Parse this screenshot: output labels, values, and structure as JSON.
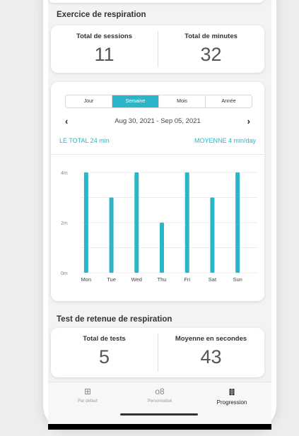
{
  "breathing_exercise": {
    "title": "Exercice de respiration",
    "total_sessions_label": "Total de sessions",
    "total_sessions_value": "11",
    "total_minutes_label": "Total de minutes",
    "total_minutes_value": "32"
  },
  "period_tabs": [
    {
      "label": "Jour",
      "active": false
    },
    {
      "label": "Semaine",
      "active": true
    },
    {
      "label": "Mois",
      "active": false
    },
    {
      "label": "Année",
      "active": false
    }
  ],
  "date_range": "Aug 30, 2021 - Sep 05, 2021",
  "total_text": "LE TOTAL 24 min",
  "average_text": "MOYENNE 4 min/day",
  "chart_data": {
    "type": "bar",
    "categories": [
      "Mon",
      "Tue",
      "Wed",
      "Thu",
      "Fri",
      "Sat",
      "Sun"
    ],
    "values": [
      4,
      3,
      4,
      2,
      4,
      3,
      4
    ],
    "ylim": [
      0,
      4
    ],
    "yticks": [
      "0m",
      "2m",
      "4m"
    ],
    "grid": true,
    "bar_color": "#2bb5c9"
  },
  "breath_hold": {
    "title": "Test de retenue de respiration",
    "total_tests_label": "Total de tests",
    "total_tests_value": "5",
    "average_seconds_label": "Moyenne en secondes",
    "average_seconds_value": "43"
  },
  "nav": {
    "items": [
      {
        "label": "Par défaut",
        "icon": "grid-icon"
      },
      {
        "label": "Personnalisé",
        "icon": "custom-icon"
      },
      {
        "label": "Progression",
        "icon": "chart-icon"
      }
    ]
  },
  "colors": {
    "accent": "#2bb5c9"
  }
}
